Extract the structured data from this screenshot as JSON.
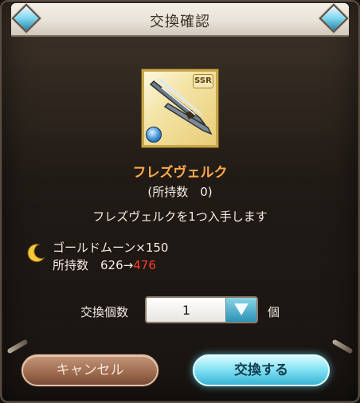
{
  "dialog": {
    "title": "交換確認"
  },
  "item": {
    "name": "フレズヴェルク",
    "owned_text": "(所持数　0)",
    "acquire_message": "フレズヴェルクを1つ入手します",
    "rarity": "SSR"
  },
  "cost": {
    "line1": "ゴールドムーン×150",
    "owned_label": "所持数　",
    "owned_before": "626",
    "arrow": "→",
    "owned_after": "476"
  },
  "quantity": {
    "label": "交換個数",
    "value": "1",
    "unit": "個"
  },
  "buttons": {
    "cancel": "キャンセル",
    "confirm": "交換する"
  },
  "colors": {
    "item_name": "#ffa84a",
    "after_value": "#ff3b2f",
    "confirm_button": "#7fe0f3",
    "cancel_button": "#9f6d52"
  }
}
